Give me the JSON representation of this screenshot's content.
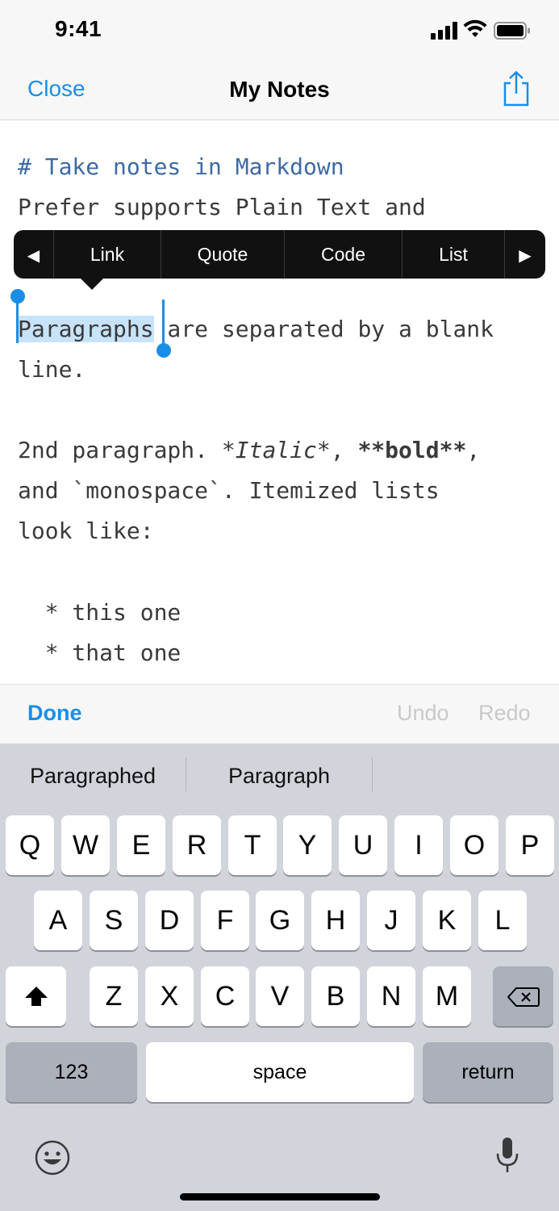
{
  "status_bar": {
    "time": "9:41"
  },
  "nav": {
    "close_label": "Close",
    "title": "My Notes"
  },
  "editor": {
    "heading_line": "# Take notes in Markdown",
    "line2": "Prefer supports Plain Text and",
    "selected_word": "Paragraphs",
    "line3_rest": " are separated by a blank",
    "line4": "line.",
    "line5a": "2nd paragraph. ",
    "line5b_italic": "*Italic*",
    "line5c": ", ",
    "line5d_bold": "**bold**",
    "line5e": ",",
    "line6": "and `monospace`. Itemized lists",
    "line7": "look like:",
    "line8": "  * this one",
    "line9": "  * that one"
  },
  "context_menu": {
    "prev": "◀",
    "items": [
      "Link",
      "Quote",
      "Code",
      "List"
    ],
    "next": "▶"
  },
  "accessory": {
    "done": "Done",
    "undo": "Undo",
    "redo": "Redo"
  },
  "keyboard": {
    "suggestions": [
      "Paragraphed",
      "Paragraph"
    ],
    "row1": [
      "Q",
      "W",
      "E",
      "R",
      "T",
      "Y",
      "U",
      "I",
      "O",
      "P"
    ],
    "row2": [
      "A",
      "S",
      "D",
      "F",
      "G",
      "H",
      "J",
      "K",
      "L"
    ],
    "row3": [
      "Z",
      "X",
      "C",
      "V",
      "B",
      "N",
      "M"
    ],
    "numbers": "123",
    "space": "space",
    "return": "return"
  },
  "colors": {
    "accent": "#1a8ee6",
    "selection": "#c7e3fa",
    "heading": "#3d6aa3"
  }
}
